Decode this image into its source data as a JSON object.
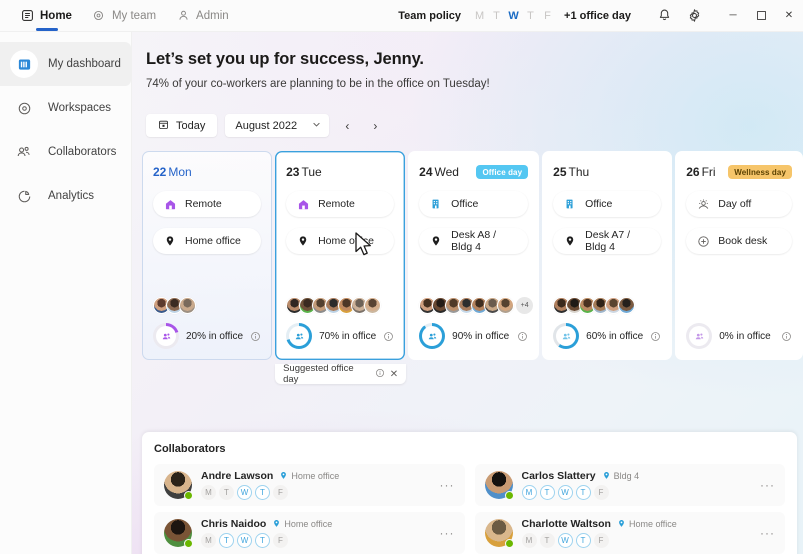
{
  "titlebar": {
    "tabs": [
      {
        "label": "Home",
        "icon": "home-list-icon",
        "active": true
      },
      {
        "label": "My team",
        "icon": "team-icon",
        "active": false
      },
      {
        "label": "Admin",
        "icon": "person-icon",
        "active": false
      }
    ],
    "policy": {
      "label": "Team policy",
      "days": [
        {
          "letter": "M",
          "on": false
        },
        {
          "letter": "T",
          "on": false
        },
        {
          "letter": "W",
          "on": true
        },
        {
          "letter": "T",
          "on": false
        },
        {
          "letter": "F",
          "on": false
        }
      ],
      "extra": "+1 office day"
    },
    "icons": [
      {
        "name": "notification-bell-icon",
        "glyph": "bell"
      },
      {
        "name": "settings-gear-icon",
        "glyph": "gear"
      }
    ],
    "window_controls": [
      {
        "name": "minimize-button",
        "glyph": "─"
      },
      {
        "name": "maximize-button",
        "glyph": "☐"
      },
      {
        "name": "close-button",
        "glyph": "✕"
      }
    ]
  },
  "sidebar": {
    "items": [
      {
        "label": "My dashboard",
        "icon": "dashboard-icon",
        "active": true
      },
      {
        "label": "Workspaces",
        "icon": "location-circle-icon",
        "active": false
      },
      {
        "label": "Collaborators",
        "icon": "people-icon",
        "active": false
      },
      {
        "label": "Analytics",
        "icon": "pie-chart-icon",
        "active": false
      }
    ]
  },
  "hero": {
    "title": "Let’s set you up for success, Jenny.",
    "subtitle": "74% of your co-workers are planning to be in the office on Tuesday!"
  },
  "datebar": {
    "today_label": "Today",
    "today_icon": "calendar-icon",
    "month_value": "August 2022",
    "prev_label": "‹",
    "next_label": "›"
  },
  "days": [
    {
      "date": "22",
      "dow": "Mon",
      "state": "selected",
      "badge": null,
      "mode": {
        "label": "Remote",
        "icon": "home-remote-icon"
      },
      "place": {
        "label": "Home office",
        "icon": "pin-icon"
      },
      "avatar_count": 3,
      "avatar_overflow": null,
      "occupancy": "20% in office",
      "occupancy_pct": 20,
      "donut_color": "#a855e8",
      "suggested": null
    },
    {
      "date": "23",
      "dow": "Tue",
      "state": "suggested",
      "badge": null,
      "mode": {
        "label": "Remote",
        "icon": "home-remote-icon"
      },
      "place": {
        "label": "Home office",
        "icon": "pin-icon"
      },
      "avatar_count": 7,
      "avatar_overflow": null,
      "occupancy": "70% in office",
      "occupancy_pct": 70,
      "donut_color": "#2b9fd8",
      "suggested": {
        "label": "Suggested office day",
        "close": "✕"
      }
    },
    {
      "date": "24",
      "dow": "Wed",
      "state": "plain",
      "badge": {
        "text": "Office day",
        "kind": "office"
      },
      "mode": {
        "label": "Office",
        "icon": "building-icon"
      },
      "place": {
        "label": "Desk A8 / Bldg 4",
        "icon": "pin-icon"
      },
      "avatar_count": 7,
      "avatar_overflow": "+4",
      "occupancy": "90% in office",
      "occupancy_pct": 90,
      "donut_color": "#2b9fd8",
      "suggested": null
    },
    {
      "date": "25",
      "dow": "Thu",
      "state": "plain",
      "badge": null,
      "mode": {
        "label": "Office",
        "icon": "building-icon"
      },
      "place": {
        "label": "Desk A7 / Bldg 4",
        "icon": "pin-icon"
      },
      "avatar_count": 6,
      "avatar_overflow": null,
      "occupancy": "60% in office",
      "occupancy_pct": 60,
      "donut_color": "#2b9fd8",
      "suggested": null
    },
    {
      "date": "26",
      "dow": "Fri",
      "state": "plain",
      "badge": {
        "text": "Wellness day",
        "kind": "wellness"
      },
      "mode": {
        "label": "Day off",
        "icon": "sun-icon"
      },
      "place": {
        "label": "Book desk",
        "icon": "plus-circle-icon"
      },
      "avatar_count": 0,
      "avatar_overflow": null,
      "occupancy": "0% in office",
      "occupancy_pct": 0,
      "donut_color": "#a855e8",
      "suggested": null
    }
  ],
  "collaborators": {
    "title": "Collaborators",
    "left": [
      {
        "name": "Andre Lawson",
        "location": "Home office",
        "location_icon": "pin-icon",
        "presence": "available",
        "days": [
          {
            "letter": "M",
            "on": false
          },
          {
            "letter": "T",
            "on": false
          },
          {
            "letter": "W",
            "on": true
          },
          {
            "letter": "T",
            "on": true
          },
          {
            "letter": "F",
            "on": false
          }
        ],
        "more": "···"
      },
      {
        "name": "Chris Naidoo",
        "location": "Home office",
        "location_icon": "pin-icon",
        "presence": "available",
        "days": [
          {
            "letter": "M",
            "on": false
          },
          {
            "letter": "T",
            "on": true
          },
          {
            "letter": "W",
            "on": true
          },
          {
            "letter": "T",
            "on": true
          },
          {
            "letter": "F",
            "on": false
          }
        ],
        "more": "···"
      }
    ],
    "right": [
      {
        "name": "Carlos Slattery",
        "location": "Bldg 4",
        "location_icon": "pin-icon",
        "presence": "available",
        "days": [
          {
            "letter": "M",
            "on": true
          },
          {
            "letter": "T",
            "on": true
          },
          {
            "letter": "W",
            "on": true
          },
          {
            "letter": "T",
            "on": true
          },
          {
            "letter": "F",
            "on": false
          }
        ],
        "more": "···"
      },
      {
        "name": "Charlotte Waltson",
        "location": "Home office",
        "location_icon": "pin-icon",
        "presence": "available",
        "days": [
          {
            "letter": "M",
            "on": false
          },
          {
            "letter": "T",
            "on": false
          },
          {
            "letter": "W",
            "on": true
          },
          {
            "letter": "T",
            "on": true
          },
          {
            "letter": "F",
            "on": false
          }
        ],
        "more": "···"
      }
    ]
  },
  "colors": {
    "accent_blue": "#2563c9",
    "office_badge": "#54c7f2",
    "wellness_badge": "#f6c56a",
    "remote_purple": "#a855e8",
    "presence_green": "#6bb700"
  }
}
